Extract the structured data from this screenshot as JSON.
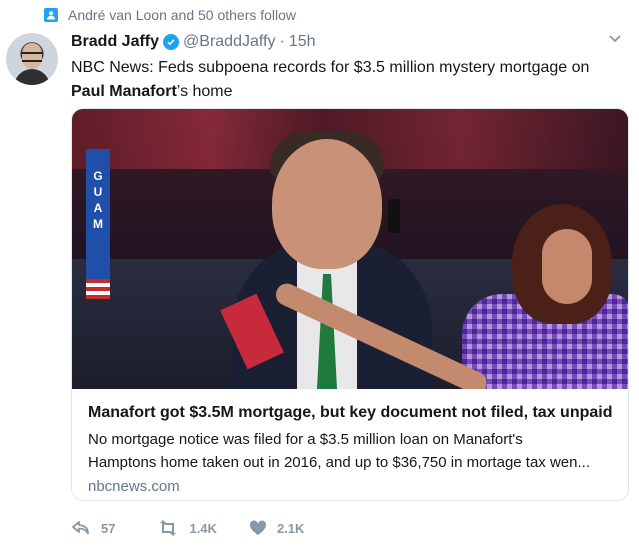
{
  "context": {
    "text": "André van Loon and 50 others follow",
    "icon": "person-icon"
  },
  "tweet": {
    "author_name": "Bradd Jaffy",
    "handle": "@BraddJaffy",
    "separator": "·",
    "time": "15h",
    "text_part1": "NBC News: Feds subpoena records for $3.5 million mystery mortgage on ",
    "text_bold": "Paul Manafort",
    "text_part2": "’s home"
  },
  "card": {
    "image_label": "GUAM",
    "title": "Manafort got $3.5M mortgage, but key document not filed, tax unpaid",
    "description_line1": "No mortgage notice was filed for a $3.5 million loan on Manafort's",
    "description_line2": "Hamptons home taken out in 2016, and up to $36,750 in mortage tax wen...",
    "domain": "nbcnews.com"
  },
  "actions": {
    "reply_count": "57",
    "retweet_count": "1.4K",
    "like_count": "2.1K"
  },
  "colors": {
    "accent": "#1da1f2",
    "muted": "#657786",
    "icon_gray": "#8899a6",
    "border": "#e1e8ed"
  }
}
